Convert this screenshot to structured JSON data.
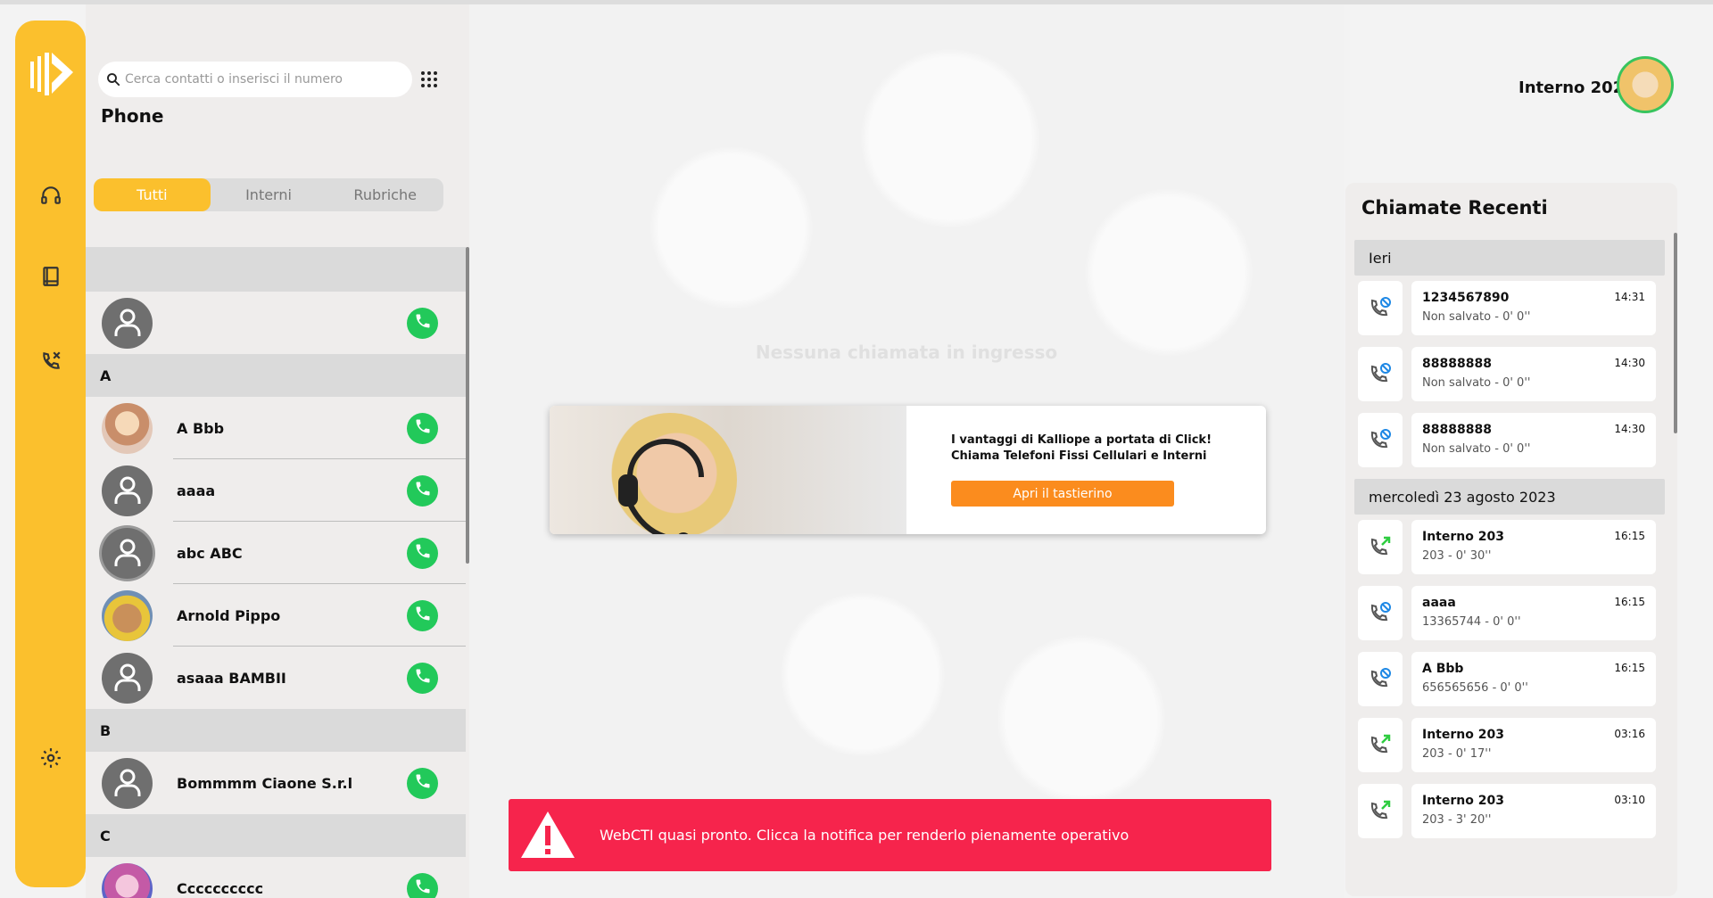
{
  "app": {
    "section_title": "Phone"
  },
  "search": {
    "placeholder": "Cerca contatti o inserisci il numero"
  },
  "filters": [
    {
      "label": "Tutti",
      "active": true
    },
    {
      "label": "Interni",
      "active": false
    },
    {
      "label": "Rubriche",
      "active": false
    }
  ],
  "contacts": {
    "sections": [
      {
        "letter": "",
        "items": [
          {
            "name": "",
            "avatar": "default"
          }
        ]
      },
      {
        "letter": "A",
        "items": [
          {
            "name": "A Bbb",
            "avatar": "photo-a"
          },
          {
            "name": "aaaa",
            "avatar": "default"
          },
          {
            "name": "abc ABC",
            "avatar": "default-ring"
          },
          {
            "name": "Arnold Pippo",
            "avatar": "photo-arnold"
          },
          {
            "name": "asaaa BAMBII",
            "avatar": "default"
          }
        ]
      },
      {
        "letter": "B",
        "items": [
          {
            "name": "Bommmm Ciaone S.r.l",
            "avatar": "default"
          }
        ]
      },
      {
        "letter": "C",
        "items": [
          {
            "name": "Cccccccccc",
            "avatar": "photo-c"
          }
        ]
      }
    ]
  },
  "main": {
    "no_calls_text": "Nessuna chiamata in ingresso",
    "promo": {
      "line1": "I vantaggi di Kalliope a portata di Click!",
      "line2": "Chiama Telefoni Fissi Cellulari e Interni",
      "button_label": "Apri il tastierino"
    },
    "toast": {
      "text": "WebCTI quasi pronto. Clicca la notifica per renderlo pienamente operativo",
      "color": "#f6244c"
    }
  },
  "user": {
    "label": "Interno 202"
  },
  "recent": {
    "title": "Chiamate Recenti",
    "groups": [
      {
        "day": "Ieri",
        "calls": [
          {
            "name": "1234567890",
            "detail": "Non salvato - 0' 0''",
            "time": "14:31",
            "type": "missed"
          },
          {
            "name": "88888888",
            "detail": "Non salvato - 0' 0''",
            "time": "14:30",
            "type": "missed"
          },
          {
            "name": "88888888",
            "detail": "Non salvato - 0' 0''",
            "time": "14:30",
            "type": "missed"
          }
        ]
      },
      {
        "day": "mercoledì 23 agosto 2023",
        "calls": [
          {
            "name": "Interno 203",
            "detail": "203 - 0' 30''",
            "time": "16:15",
            "type": "outgoing"
          },
          {
            "name": "aaaa",
            "detail": "13365744 - 0' 0''",
            "time": "16:15",
            "type": "missed"
          },
          {
            "name": "A Bbb",
            "detail": "656565656 - 0' 0''",
            "time": "16:15",
            "type": "missed"
          },
          {
            "name": "Interno 203",
            "detail": "203 - 0' 17''",
            "time": "03:16",
            "type": "outgoing"
          },
          {
            "name": "Interno 203",
            "detail": "203 - 3' 20''",
            "time": "03:10",
            "type": "outgoing"
          }
        ]
      }
    ]
  },
  "colors": {
    "accent": "#fbc02d",
    "call_green": "#22c95a",
    "promo_orange": "#fb8c1e",
    "missed_blue": "#1e88e5",
    "outgoing_green": "#2ecc40"
  }
}
